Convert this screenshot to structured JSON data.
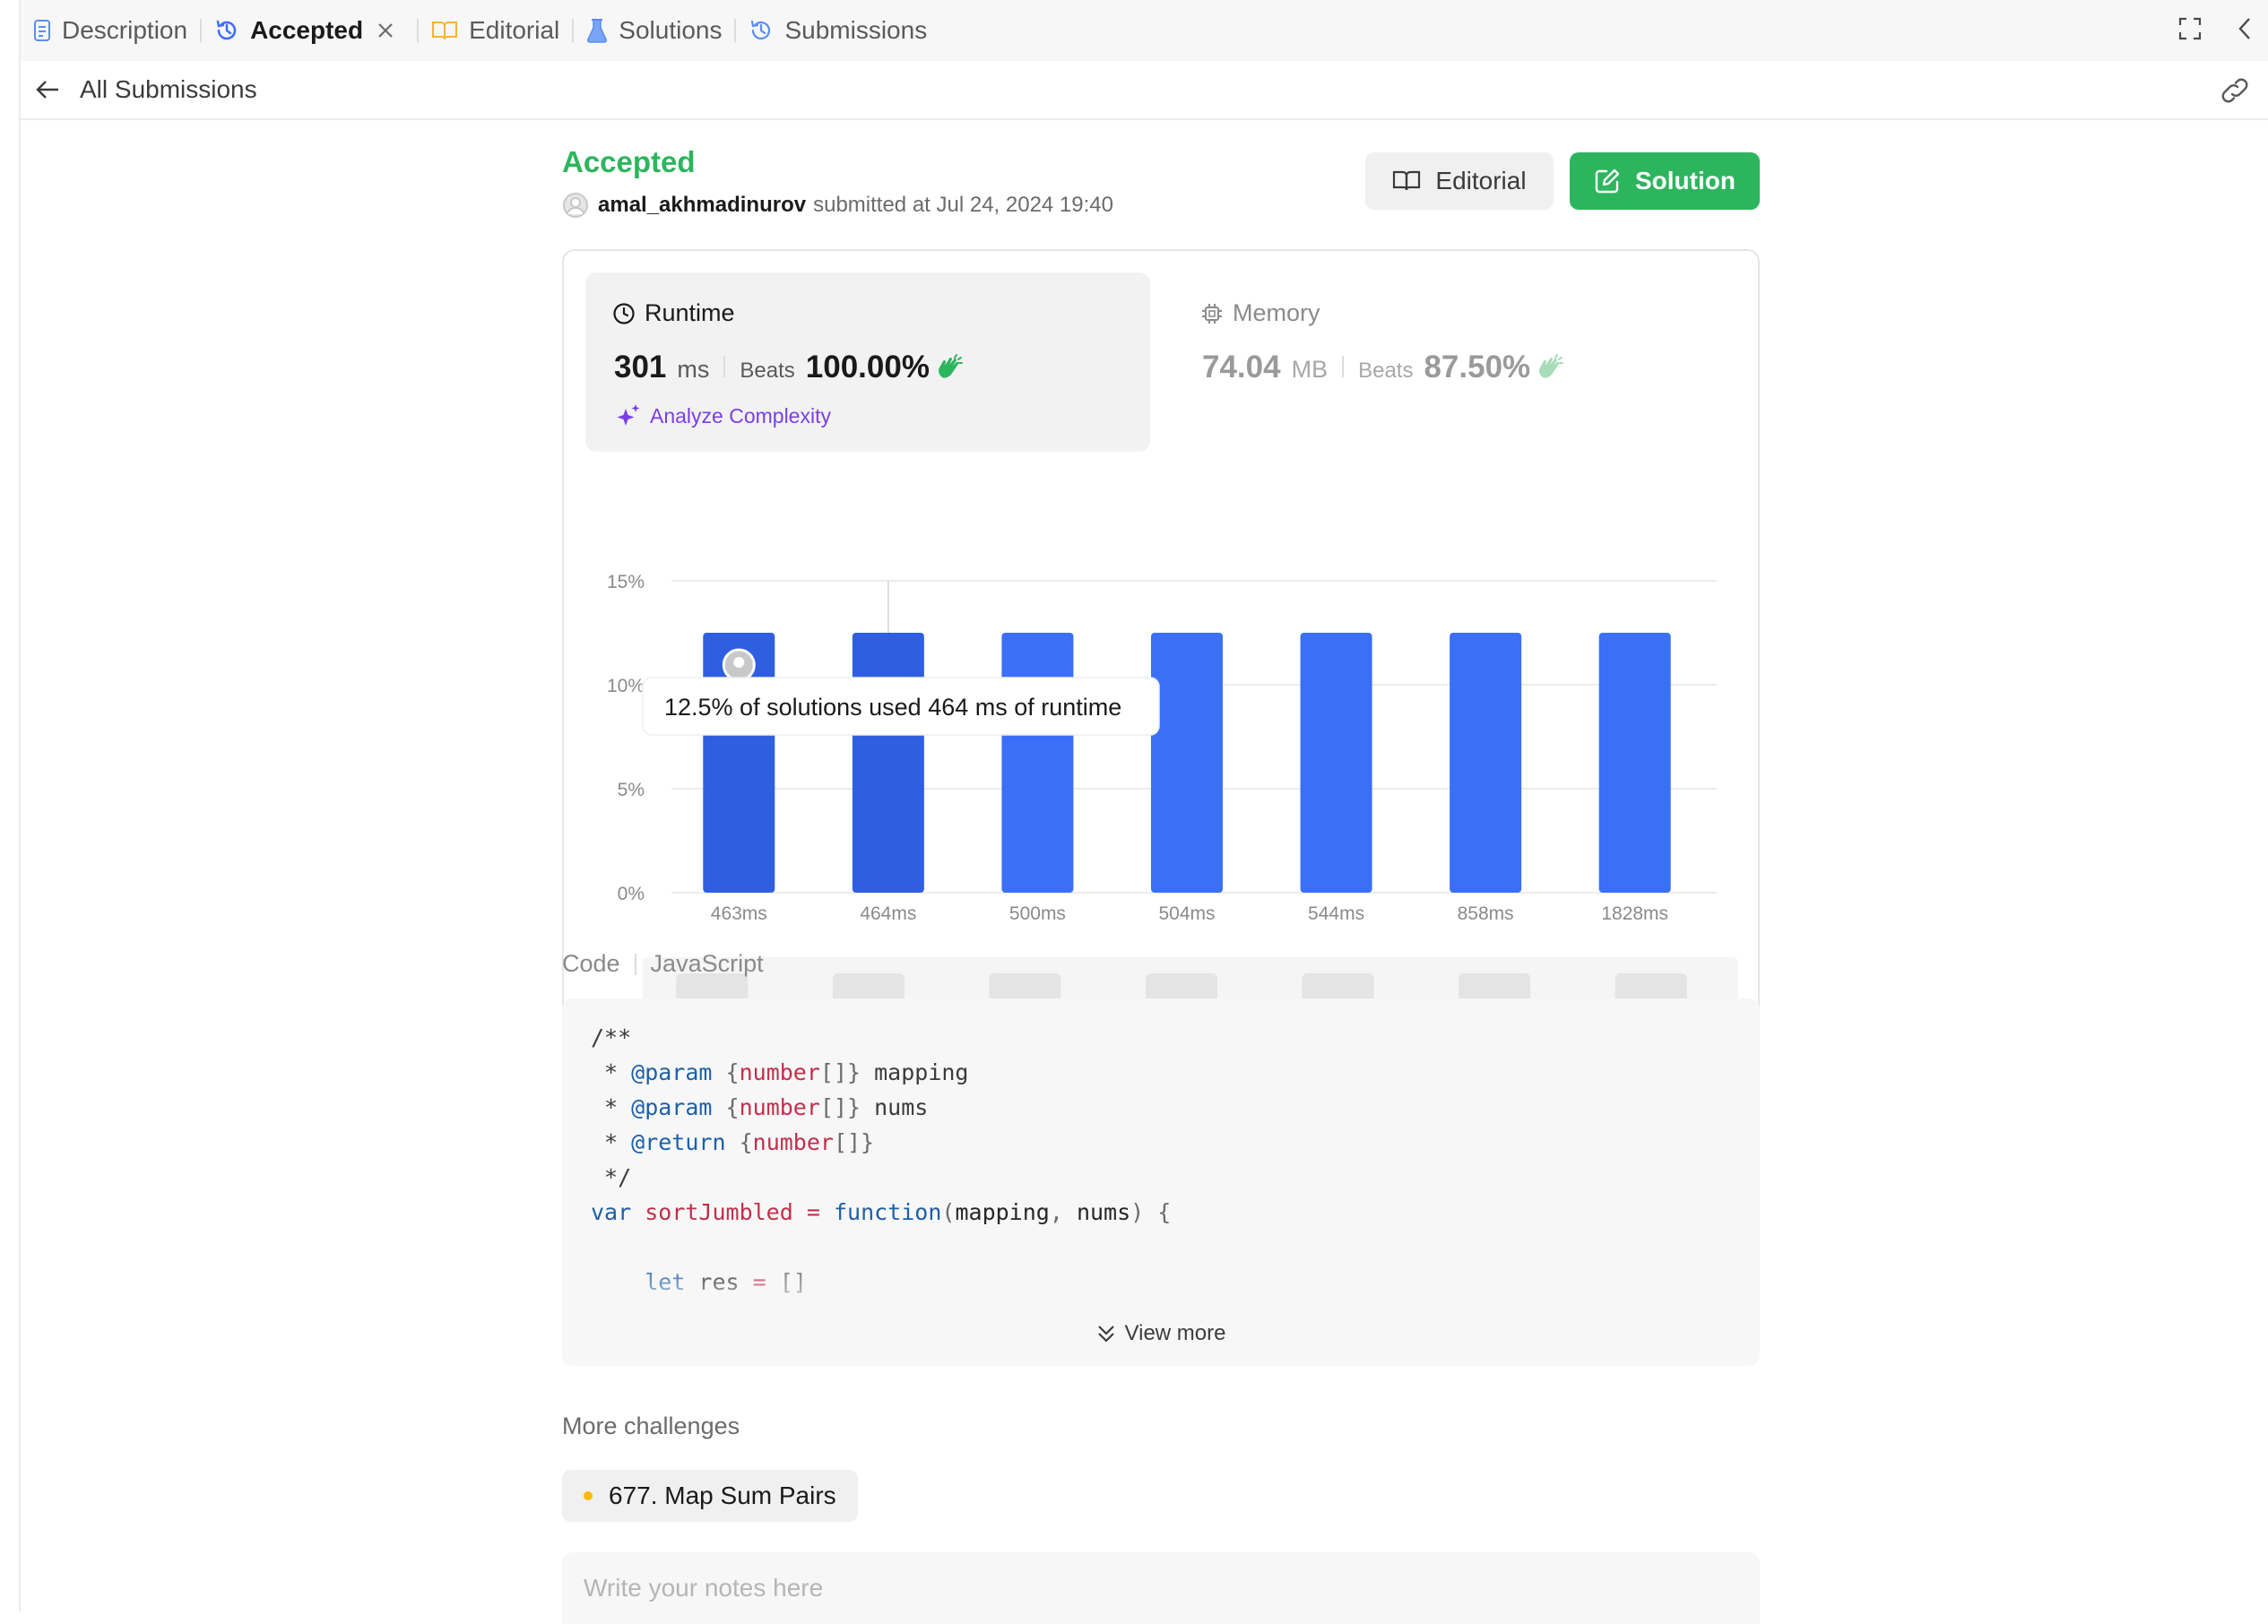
{
  "tabs": [
    {
      "label": "Description",
      "icon": "description-icon"
    },
    {
      "label": "Accepted",
      "icon": "history-icon"
    },
    {
      "label": "Editorial",
      "icon": "book-icon"
    },
    {
      "label": "Solutions",
      "icon": "flask-icon"
    },
    {
      "label": "Submissions",
      "icon": "history-icon"
    }
  ],
  "subbar": {
    "back_label": "All Submissions"
  },
  "submission": {
    "status": "Accepted",
    "username": "amal_akhmadinurov",
    "submitted_text": "submitted at Jul 24, 2024 19:40"
  },
  "buttons": {
    "editorial": "Editorial",
    "solution": "Solution"
  },
  "runtime": {
    "title": "Runtime",
    "value": "301",
    "unit": "ms",
    "beats_label": "Beats",
    "beats_value": "100.00%",
    "analyze_label": "Analyze Complexity"
  },
  "memory": {
    "title": "Memory",
    "value": "74.04",
    "unit": "MB",
    "beats_label": "Beats",
    "beats_value": "87.50%"
  },
  "colors": {
    "accepted": "#2db55d",
    "bar": "#3a6ff7",
    "bar_highlight": "#2f5fe0",
    "analyze": "#7a3fe4"
  },
  "chart_data": {
    "type": "bar",
    "categories": [
      "463ms",
      "464ms",
      "500ms",
      "504ms",
      "544ms",
      "858ms",
      "1828ms"
    ],
    "values": [
      12.5,
      12.5,
      12.5,
      12.5,
      12.5,
      12.5,
      12.5
    ],
    "yticks": [
      "0%",
      "5%",
      "10%",
      "15%"
    ],
    "ylim": [
      0,
      15
    ],
    "grid": true,
    "highlighted": [
      "463ms",
      "464ms"
    ],
    "tooltip": "12.5% of solutions used 464 ms of runtime",
    "overview_labels": [
      "463ms",
      "464ms",
      "500ms",
      "504ms",
      "544ms",
      "858ms",
      "1828ms"
    ]
  },
  "code": {
    "label": "Code",
    "language": "JavaScript",
    "view_more": "View more"
  },
  "more_challenges": {
    "title": "More challenges",
    "items": [
      {
        "label": "677. Map Sum Pairs"
      }
    ]
  },
  "notes": {
    "placeholder": "Write your notes here"
  }
}
